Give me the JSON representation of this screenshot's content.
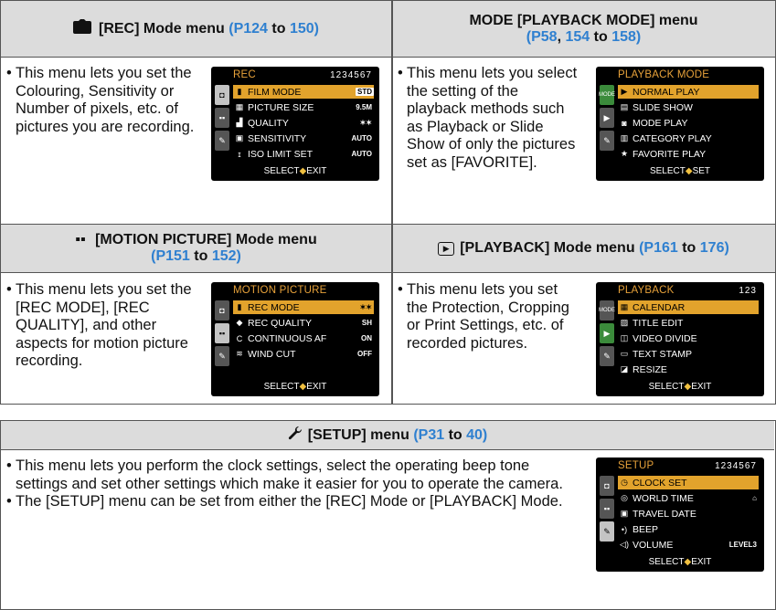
{
  "rec_menu": {
    "heading": "[REC] Mode menu",
    "ref_open": "(P124",
    "ref_to": "to",
    "ref_close": "150)",
    "text": "This menu lets you set the Colouring, Sensitivity or Number of pixels, etc. of pictures you are recording.",
    "screen": {
      "title": "REC",
      "pages": "1234567",
      "items": [
        {
          "icon": "film-icon",
          "label": "FILM MODE",
          "value": "STD",
          "highlighted": true
        },
        {
          "icon": "picture-size-icon",
          "label": "PICTURE SIZE",
          "value": "9.5M",
          "highlighted": false
        },
        {
          "icon": "quality-icon",
          "label": "QUALITY",
          "value": "✶✶",
          "highlighted": false
        },
        {
          "icon": "iso-icon",
          "label": "SENSITIVITY",
          "value": "AUTO",
          "highlighted": false
        },
        {
          "icon": "iso-limit-icon",
          "label": "ISO LIMIT SET",
          "value": "AUTO",
          "highlighted": false
        }
      ],
      "footer_select": "SELECT",
      "footer_exit": "EXIT"
    }
  },
  "playback_mode_menu": {
    "heading": "MODE [PLAYBACK MODE] menu",
    "ref_p58": "(P58",
    "ref_comma": ",",
    "ref_154": "154",
    "ref_to": "to",
    "ref_158": "158)",
    "text": "This menu lets you select the setting of the playback methods such as Playback or Slide Show of only the pictures set as [FAVORITE].",
    "screen": {
      "title": "PLAYBACK MODE",
      "side_label": "MODE",
      "items": [
        {
          "icon": "play-icon",
          "label": "NORMAL PLAY",
          "highlighted": true
        },
        {
          "icon": "slideshow-icon",
          "label": "SLIDE SHOW",
          "highlighted": false
        },
        {
          "icon": "mode-play-icon",
          "label": "MODE PLAY",
          "highlighted": false
        },
        {
          "icon": "category-icon",
          "label": "CATEGORY PLAY",
          "highlighted": false
        },
        {
          "icon": "star-icon",
          "label": "FAVORITE PLAY",
          "highlighted": false
        }
      ],
      "footer_select": "SELECT",
      "footer_set": "SET"
    }
  },
  "motion_menu": {
    "heading": "[MOTION PICTURE] Mode menu",
    "ref_open": "(P151",
    "ref_to": "to",
    "ref_close": "152)",
    "text": "This menu lets you set the [REC MODE], [REC QUALITY], and other aspects for motion picture recording.",
    "screen": {
      "title": "MOTION PICTURE",
      "items": [
        {
          "icon": "rec-mode-icon",
          "label": "REC MODE",
          "value": "✶✶",
          "highlighted": true
        },
        {
          "icon": "rec-quality-icon",
          "label": "REC QUALITY",
          "value": "SH",
          "highlighted": false
        },
        {
          "icon": "caf-icon",
          "label": "CONTINUOUS AF",
          "value": "ON",
          "highlighted": false
        },
        {
          "icon": "wind-icon",
          "label": "WIND CUT",
          "value": "OFF",
          "highlighted": false
        }
      ],
      "footer_select": "SELECT",
      "footer_exit": "EXIT"
    }
  },
  "playback_menu": {
    "heading": "[PLAYBACK] Mode menu",
    "ref_open": "(P161",
    "ref_to": "to",
    "ref_close": "176)",
    "text": "This menu lets you set the Protection, Cropping or Print Settings, etc. of recorded pictures.",
    "screen": {
      "title": "PLAYBACK",
      "pages": "123",
      "side_label": "MODE",
      "items": [
        {
          "icon": "calendar-icon",
          "label": "CALENDAR",
          "highlighted": true
        },
        {
          "icon": "title-edit-icon",
          "label": "TITLE EDIT",
          "highlighted": false
        },
        {
          "icon": "video-divide-icon",
          "label": "VIDEO DIVIDE",
          "highlighted": false
        },
        {
          "icon": "text-stamp-icon",
          "label": "TEXT STAMP",
          "highlighted": false
        },
        {
          "icon": "resize-icon",
          "label": "RESIZE",
          "highlighted": false
        }
      ],
      "footer_select": "SELECT",
      "footer_exit": "EXIT"
    }
  },
  "setup_menu": {
    "heading": "[SETUP] menu",
    "ref_open": "(P31",
    "ref_to": "to",
    "ref_close": "40)",
    "bullets": [
      "This menu lets you perform the clock settings, select the operating beep tone settings and set other settings which make it easier for you to operate the camera.",
      "The [SETUP] menu can be set from either the [REC] Mode or [PLAYBACK] Mode."
    ],
    "screen": {
      "title": "SETUP",
      "pages": "1234567",
      "items": [
        {
          "icon": "clock-icon",
          "label": "CLOCK SET",
          "value": "",
          "highlighted": true
        },
        {
          "icon": "world-time-icon",
          "label": "WORLD TIME",
          "value": "⌂",
          "highlighted": false
        },
        {
          "icon": "travel-date-icon",
          "label": "TRAVEL DATE",
          "value": "",
          "highlighted": false
        },
        {
          "icon": "beep-icon",
          "label": "BEEP",
          "value": "",
          "highlighted": false
        },
        {
          "icon": "volume-icon",
          "label": "VOLUME",
          "value": "LEVEL3",
          "highlighted": false
        }
      ],
      "footer_select": "SELECT",
      "footer_exit": "EXIT"
    }
  }
}
